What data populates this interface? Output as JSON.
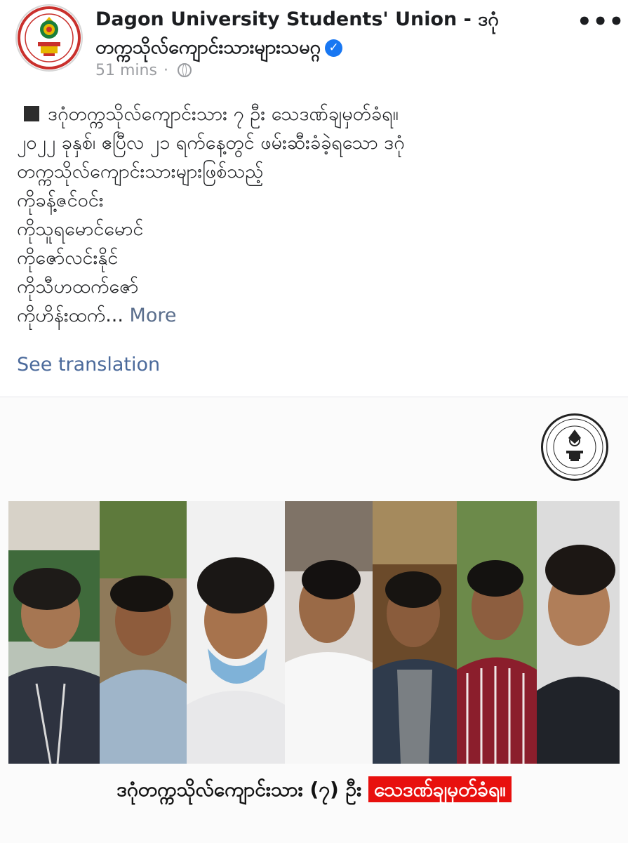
{
  "post": {
    "page_name": "Dagon University Students' Union - ဒဂုံတက္ကသိုလ်ကျောင်းသားများသမဂ္ဂ",
    "time": "51 mins",
    "separator": "·",
    "text_lines": [
      "ဒဂုံတက္ကသိုလ်ကျောင်းသား ၇ ဦး သေဒဏ်ချမှတ်ခံရ။",
      "၂၀၂၂ ခုနှစ်၊ ဧပြီလ ၂၁ ရက်နေ့တွင် ဖမ်းဆီးခံခဲ့ရသော ဒဂုံ",
      "တက္ကသိုလ်ကျောင်းသားများဖြစ်သည့်",
      "ကိုခန့်ဇင်ဝင်း",
      "ကိုသူရမောင်မောင်",
      "ကိုဇော်လင်းနိုင်",
      "ကိုသီဟထက်ဇော်",
      "ကိုဟိန်းထက်..."
    ],
    "more_label": "More",
    "see_translation": "See translation",
    "more_options_icon": "more-horizontal-icon",
    "audience_icon": "globe-icon",
    "verified_icon": "verified-check-icon"
  },
  "image": {
    "logo_text": "DAGON UNIVERSITY STUDENTS' UNION",
    "caption_main": "ဒဂုံတက္ကသိုလ်ကျောင်းသား (၇) ဦး",
    "caption_highlight": "သေဒဏ်ချမှတ်ခံရ။",
    "photo_count": 7
  },
  "colors": {
    "highlight_red": "#e8100e",
    "link_blue": "#4b6a9b",
    "verified_blue": "#1877f2"
  }
}
